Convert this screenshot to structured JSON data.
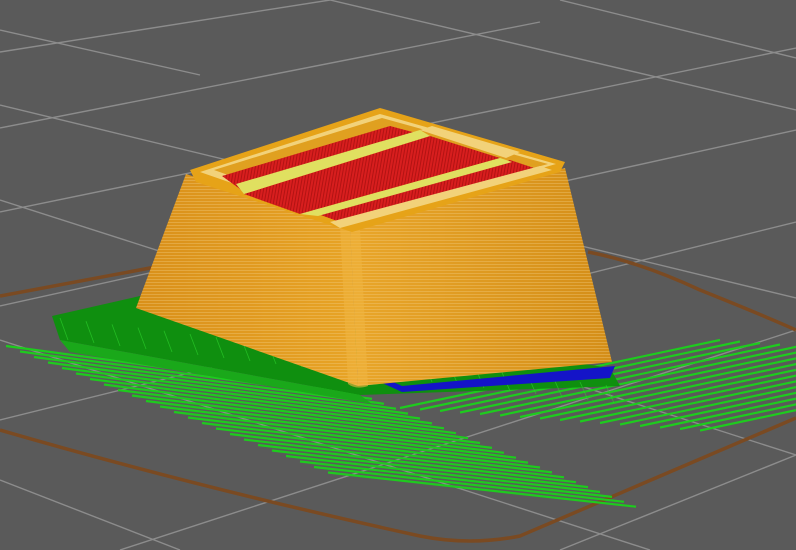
{
  "app": {
    "view": "gcode-preview-3d",
    "background_color": "#5a5a5a",
    "grid_color": "#8c8c8c",
    "bed_outline_color": "#7a4a22"
  },
  "preview": {
    "legend": [
      {
        "feature": "perimeter",
        "color": "#e6a318"
      },
      {
        "feature": "external-perimeter",
        "color": "#f2d27a"
      },
      {
        "feature": "solid-infill",
        "color": "#e0e060"
      },
      {
        "feature": "top-solid-infill",
        "color": "#d81e1e"
      },
      {
        "feature": "first-layer",
        "color": "#1414c8"
      },
      {
        "feature": "support-material",
        "color": "#1ecb1e"
      },
      {
        "feature": "support-interface",
        "color": "#0f8f0f"
      }
    ]
  }
}
